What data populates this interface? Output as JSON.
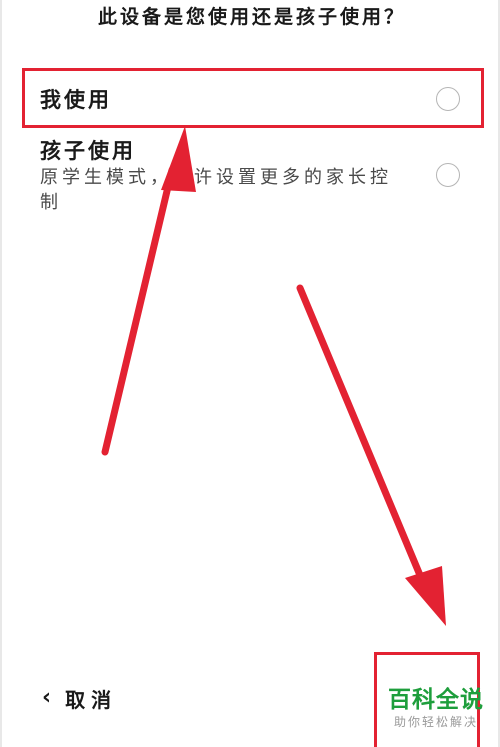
{
  "dialog": {
    "question": "此设备是您使用还是孩子使用？"
  },
  "options": [
    {
      "title": "我使用",
      "description": "",
      "selected": false
    },
    {
      "title": "孩子使用",
      "description": "原学生模式，允许设置更多的家长控制",
      "selected": false
    }
  ],
  "footer": {
    "cancel_label": "取消",
    "back_icon": "chevron-left-icon"
  },
  "annotation": {
    "color": "#e32232"
  },
  "watermark": {
    "title": "百科全说",
    "subtitle": "助你轻松解决",
    "color": "#1e9e3c"
  }
}
